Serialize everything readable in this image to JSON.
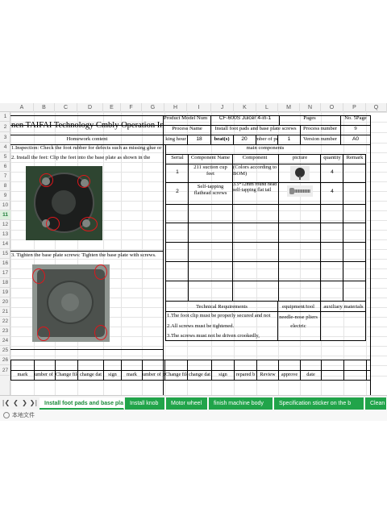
{
  "columns": [
    "A",
    "B",
    "C",
    "D",
    "E",
    "F",
    "G",
    "H",
    "I",
    "J",
    "K",
    "L",
    "M",
    "N",
    "O",
    "P",
    "Q"
  ],
  "rows": [
    "1",
    "2",
    "3",
    "4",
    "5",
    "6",
    "7",
    "8",
    "9",
    "10",
    "11",
    "12",
    "13",
    "14",
    "15",
    "16",
    "17",
    "18",
    "19",
    "20",
    "21",
    "22",
    "23",
    "24",
    "25",
    "26",
    "27"
  ],
  "selected_row": "11",
  "header": {
    "company_title": "nen TAIFAI Technology C",
    "doc_title": "mbly Operation Instru",
    "product_model_label": "Product Model Num",
    "product_model_value": "CF-600S Juicer 4-in-1",
    "pages_label": "Pages",
    "pages_value": "No. 5Page",
    "process_name_label": "Process Name",
    "process_name_value": "Install foot pads and base plate screws",
    "process_number_label": "Process number",
    "process_number_value": "9",
    "homework_label": "Homework content",
    "working_hour_label": "king hour",
    "working_hour_value": "18",
    "beat_label": "beat(s)",
    "beat_value": "20",
    "number_label": "mber of pe",
    "number_value": "1",
    "version_label": "Version number",
    "version_value": "A0"
  },
  "steps": {
    "step1": "1.Inspection: Check the foot rubber for defects such as missing glue or",
    "step2": "2. Install the feet: Clip the feet into the base plate as shown in the",
    "step3": "3. Tighten the base plate screws: Tighten the base plate with screws."
  },
  "components": {
    "title": "main components",
    "headers": [
      "Serial",
      "Component Name",
      "Component",
      "picture",
      "quantity",
      "Remark"
    ],
    "rows": [
      {
        "serial": "1",
        "name": "211 suction cup feet",
        "component": "(Colors according to BOM)",
        "quantity": "4"
      },
      {
        "serial": "2",
        "name": "Self-tapping flathead screws",
        "component": "3.5*12mm round head self-tapping flat tail",
        "quantity": "4"
      }
    ]
  },
  "requirements": {
    "title": "Technical Requirements",
    "equipment_label": "equipment/tool",
    "auxiliary_label": "auxiliary materials",
    "items": [
      "1.The foot clip must be properly secured and not",
      "2.All screws must be tightened.",
      "3.The screws must not be driven crookedly,"
    ],
    "tools": [
      "needle-nose pliers",
      "electric"
    ]
  },
  "footer": [
    "mark",
    "umber of pl",
    "Change file number",
    "change dat",
    "sign",
    "mark",
    "umber of pl",
    "Change file number",
    "change dat",
    "sign",
    "repared b",
    "Review",
    "approve",
    "date"
  ],
  "tabs": [
    {
      "label": "Install foot pads and base pla",
      "active": true
    },
    {
      "label": "Install knob",
      "active": false
    },
    {
      "label": "Motor wheel",
      "active": false
    },
    {
      "label": "finish machine body",
      "active": false
    },
    {
      "label": "Specification sticker on the b",
      "active": false
    },
    {
      "label": "Clean th",
      "active": false
    }
  ],
  "nav_icons": [
    "first-sheet-icon",
    "prev-sheet-icon",
    "next-sheet-icon",
    "last-sheet-icon"
  ],
  "status_text": "本地文件"
}
